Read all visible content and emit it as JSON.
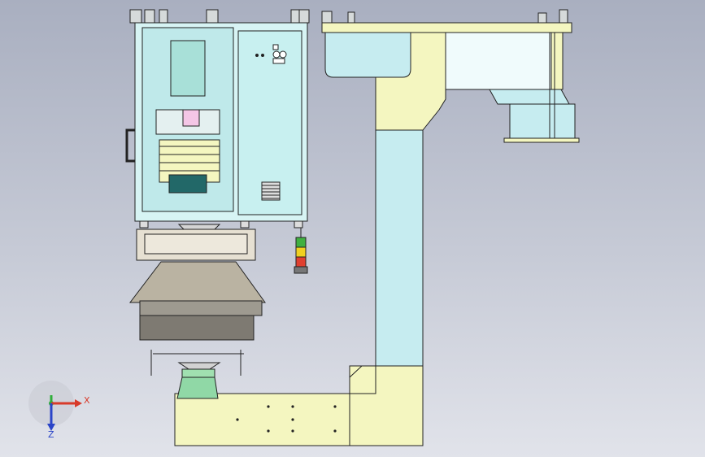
{
  "viewport": {
    "background_top": "#a9afc0",
    "background_bottom": "#e1e3ea"
  },
  "colors": {
    "panel_cyan": "#c8f0f0",
    "pale_yellow": "#f4f6c0",
    "column_blue": "#c6ecf0",
    "head_beige": "#e6e0d2",
    "chute_green": "#a0e0b0",
    "line": "#222222",
    "light_red": "#e04030",
    "light_yellow": "#f0d020",
    "light_green": "#40b040"
  },
  "parts": [
    "cabinet",
    "control-panel",
    "vent-grille",
    "signal-light-tower",
    "multihead-weigher",
    "discharge-chute",
    "support-column",
    "top-beam",
    "base-platform",
    "handle",
    "leveling-feet"
  ],
  "triad": {
    "x_label": "X",
    "z_label": "Z",
    "x_color": "#d83a2a",
    "y_color": "#2fae3a",
    "z_color": "#2a44c8"
  }
}
